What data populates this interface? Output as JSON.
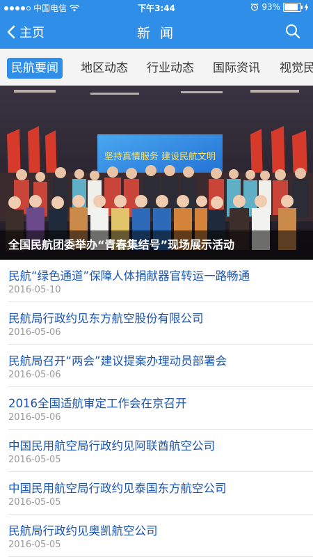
{
  "status_bar": {
    "carrier": "中国电信",
    "time": "下午3:44",
    "battery": "93%",
    "battery_level": 0.93
  },
  "nav": {
    "back_label": "主页",
    "title": "新 闻"
  },
  "tabs": [
    {
      "label": "民航要闻"
    },
    {
      "label": "地区动态"
    },
    {
      "label": "行业动态"
    },
    {
      "label": "国际资讯"
    },
    {
      "label": "视觉民"
    }
  ],
  "hero": {
    "caption": "全国民航团委举办“青春集结号”现场展示活动",
    "banner_text": "坚持真情服务 建设民航文明"
  },
  "news": [
    {
      "title": "民航“绿色通道”保障人体捐献器官转运一路畅通",
      "date": "2016-05-10"
    },
    {
      "title": "民航局行政约见东方航空股份有限公司",
      "date": "2016-05-06"
    },
    {
      "title": "民航局召开“两会”建议提案办理动员部署会",
      "date": "2016-05-06"
    },
    {
      "title": "2016全国适航审定工作会在京召开",
      "date": "2016-05-06"
    },
    {
      "title": "中国民用航空局行政约见阿联酋航空公司",
      "date": "2016-05-05"
    },
    {
      "title": "中国民用航空局行政约见泰国东方航空公司",
      "date": "2016-05-05"
    },
    {
      "title": "民航局行政约见奥凯航空公司",
      "date": "2016-05-05"
    }
  ],
  "colors": {
    "accent": "#2f8fe8",
    "link": "#1a54b0",
    "date": "#9a9a9a"
  },
  "icons": {
    "back": "chevron-left-icon",
    "search": "search-icon",
    "wifi": "wifi-icon",
    "alarm": "alarm-icon",
    "charging": "charging-icon"
  }
}
